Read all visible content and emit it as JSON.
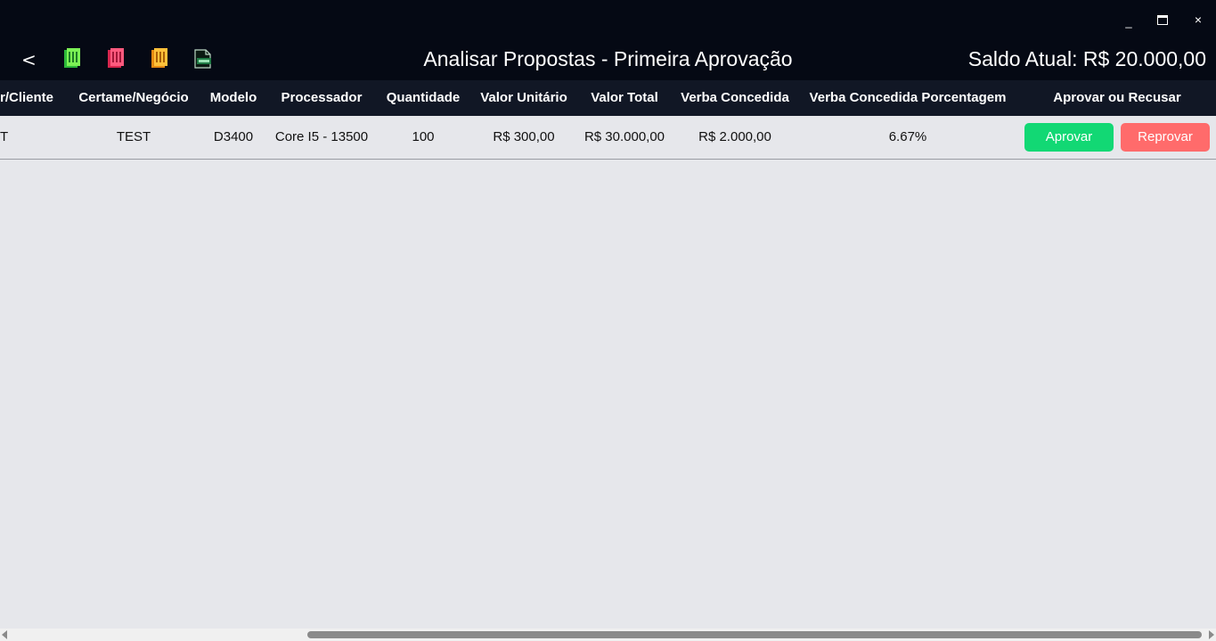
{
  "window": {
    "minimize_label": "_",
    "close_label": "×"
  },
  "header": {
    "back_label": "<",
    "title": "Analisar Propostas - Primeira Aprovação",
    "balance": "Saldo Atual: R$ 20.000,00"
  },
  "toolbar_icons": [
    "green-document-icon",
    "red-document-icon",
    "orange-document-icon",
    "xlsx-export-icon"
  ],
  "table": {
    "columns": [
      "r/Cliente",
      "Certame/Negócio",
      "Modelo",
      "Processador",
      "Quantidade",
      "Valor Unitário",
      "Valor Total",
      "Verba Concedida",
      "Verba Concedida Porcentagem",
      "Aprovar ou Recusar"
    ],
    "rows": [
      {
        "cliente": "T",
        "certame": "TEST",
        "modelo": "D3400",
        "processador": "Core I5 - 13500",
        "quantidade": "100",
        "valor_unitario": "R$ 300,00",
        "valor_total": "R$ 30.000,00",
        "verba_concedida": "R$ 2.000,00",
        "verba_porcentagem": "6.67%",
        "approve_label": "Aprovar",
        "reject_label": "Reprovar"
      }
    ]
  },
  "colors": {
    "titlebar_bg": "#050914",
    "header_bg": "#111725",
    "body_bg": "#e6e7eb",
    "approve": "#12d874",
    "reject": "#ff6b6b"
  }
}
